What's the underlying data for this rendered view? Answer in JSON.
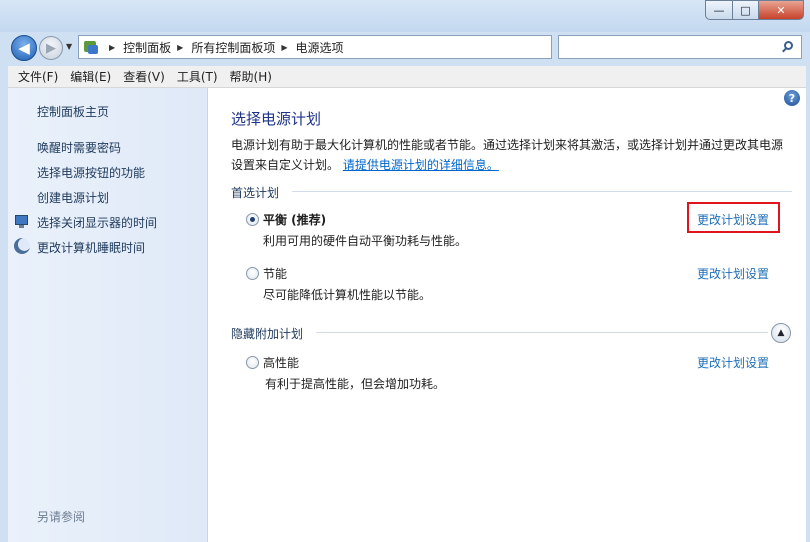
{
  "window": {
    "minimize_glyph": "—",
    "maximize_glyph": "□",
    "close_glyph": "✕"
  },
  "nav": {
    "breadcrumbs": [
      "控制面板",
      "所有控制面板项",
      "电源选项"
    ],
    "search_placeholder": ""
  },
  "menu": [
    "文件(F)",
    "编辑(E)",
    "查看(V)",
    "工具(T)",
    "帮助(H)"
  ],
  "sidebar": {
    "home": "控制面板主页",
    "links": [
      "唤醒时需要密码",
      "选择电源按钮的功能",
      "创建电源计划",
      "选择关闭显示器的时间",
      "更改计算机睡眠时间"
    ],
    "see_also": "另请参阅"
  },
  "main": {
    "title": "选择电源计划",
    "intro": "电源计划有助于最大化计算机的性能或者节能。通过选择计划来将其激活，或选择计划并通过更改其电源设置来自定义计划。",
    "intro_link": "请提供电源计划的详细信息。",
    "preferred_heading": "首选计划",
    "hidden_heading": "隐藏附加计划",
    "change_label": "更改计划设置",
    "plans": [
      {
        "name": "平衡 (推荐)",
        "desc": "利用可用的硬件自动平衡功耗与性能。",
        "selected": true
      },
      {
        "name": "节能",
        "desc": "尽可能降低计算机性能以节能。",
        "selected": false
      },
      {
        "name": "高性能",
        "desc": "有利于提高性能，但会增加功耗。",
        "selected": false
      }
    ]
  },
  "colors": {
    "accent_link": "#1f6fb8",
    "title": "#1e3287",
    "highlight": "#e0141d"
  }
}
